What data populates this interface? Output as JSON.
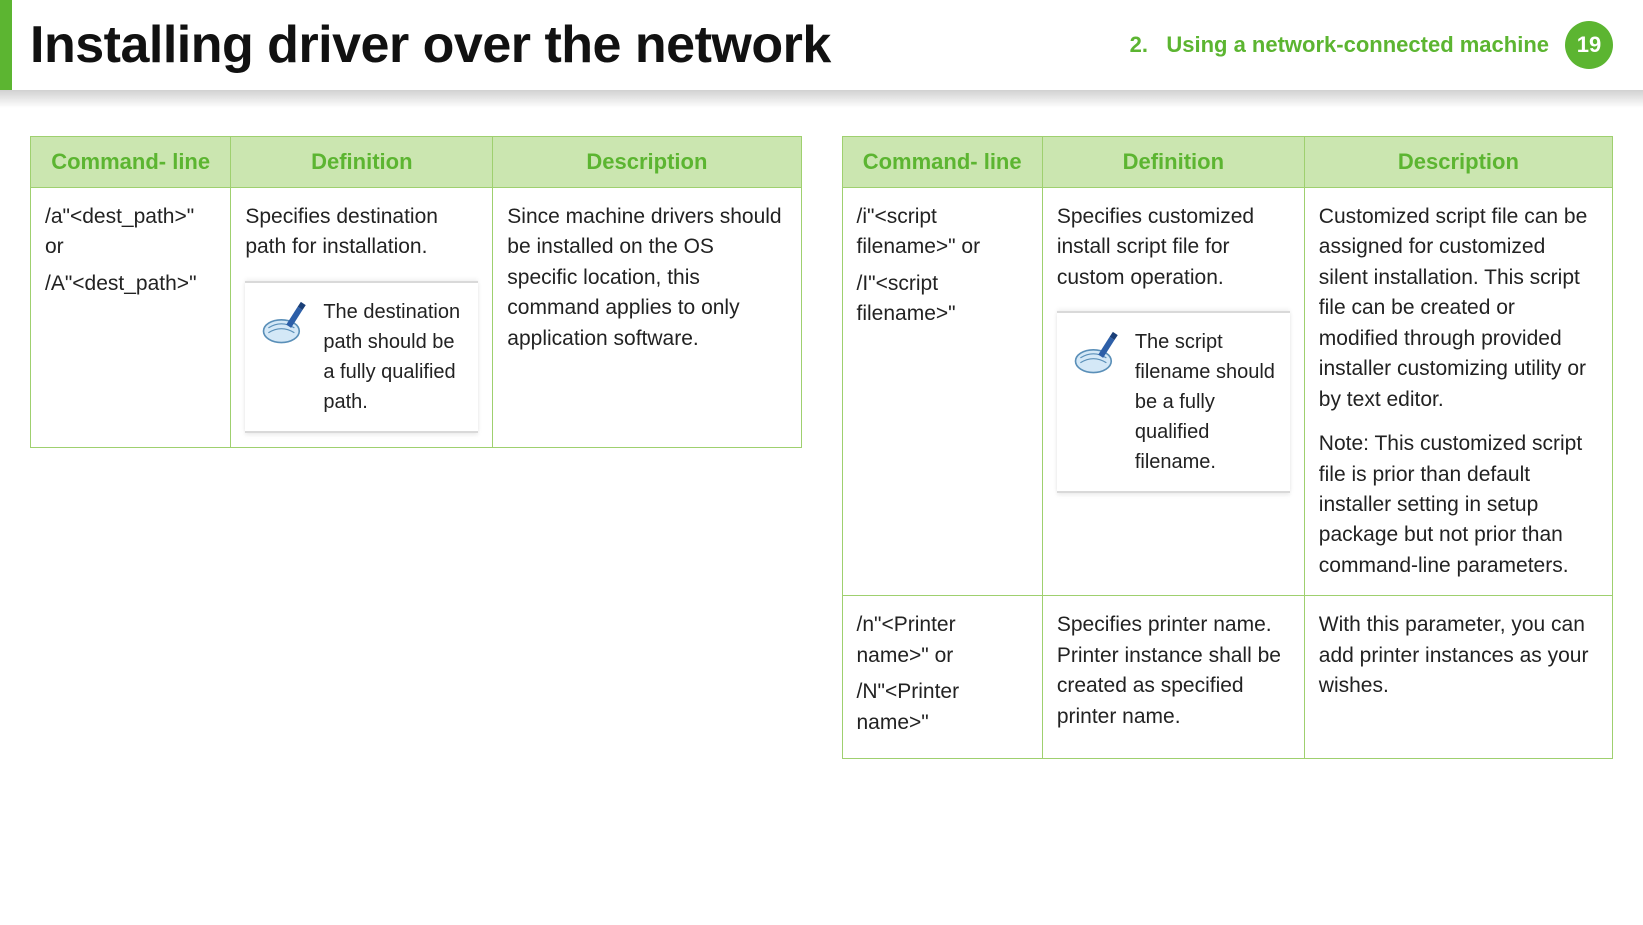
{
  "header": {
    "title": "Installing driver over the network",
    "section_number": "2.",
    "section_label": "Using a network-connected machine",
    "page_number": "19"
  },
  "table_headers": {
    "cmd": "Command- line",
    "def": "Definition",
    "desc": "Description"
  },
  "left_table": {
    "rows": [
      {
        "cmd_a": "/a\"<dest_path>\" or",
        "cmd_b": "/A\"<dest_path>\"",
        "def": "Specifies destination path for installation.",
        "note": "The destination path should be a fully qualified path.",
        "desc": "Since machine drivers should be installed on the OS specific location, this command applies to only application software."
      }
    ]
  },
  "right_table": {
    "rows": [
      {
        "cmd_a": "/i\"<script filename>\" or",
        "cmd_b": "/I\"<script filename>\"",
        "def": "Specifies customized install script file for custom operation.",
        "note": "The script filename should be a fully qualified filename.",
        "desc": "Customized script file can be assigned for customized silent installation. This script file can be created or modified through provided installer customizing utility or by text editor.",
        "desc2": "Note: This customized script file is prior than default installer setting in setup package but not prior than command-line parameters."
      },
      {
        "cmd_a": "/n\"<Printer name>\" or",
        "cmd_b": "/N\"<Printer name>\"",
        "def": "Specifies printer name. Printer instance shall be created as specified printer name.",
        "desc": "With this parameter, you can add printer instances as your wishes."
      }
    ]
  }
}
